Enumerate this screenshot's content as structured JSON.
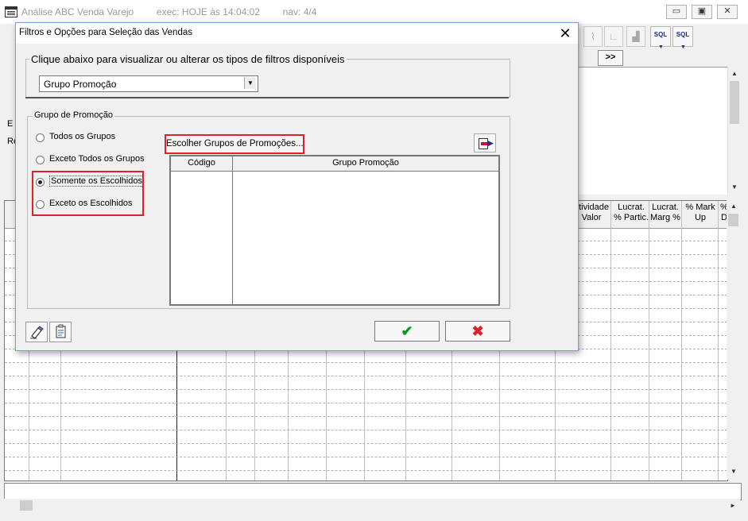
{
  "window": {
    "title": "Análise ABC Venda Varejo",
    "exec": "exec: HOJE às 14:04:02",
    "nav": "nav: 4/4",
    "minimize": "▭",
    "restore": "▣",
    "close": "✕"
  },
  "toolbar": {
    "sql_label": "SQL",
    "next_label": ">>"
  },
  "grid": {
    "headers": [
      "atividade\nValor",
      "Lucrat.\n% Partic.",
      "Lucrat.\nMarg %",
      "% Mark\nUp",
      "%\nD"
    ]
  },
  "dialog": {
    "title": "Filtros e Opções para Seleção das Vendas",
    "close": "✕",
    "filter_legend": "Clique abaixo para visualizar ou alterar os tipos de filtros disponíveis",
    "filter_select_value": "Grupo Promoção",
    "promo_legend": "Grupo de Promoção",
    "radios": [
      {
        "label": "Todos os Grupos",
        "checked": false
      },
      {
        "label": "Exceto Todos os Grupos",
        "checked": false
      },
      {
        "label": "Somente os Escolhidos",
        "checked": true
      },
      {
        "label": "Exceto os Escolhidos",
        "checked": false
      }
    ],
    "choose_button": "Escolher Grupos de Promoções...",
    "table": {
      "columns": [
        "Código",
        "Grupo Promoção"
      ]
    },
    "ok_symbol": "✔",
    "cancel_symbol": "✖"
  },
  "colors": {
    "highlight": "#e0202a",
    "ok_green": "#0a9a2a",
    "sql_blue": "#1a2e8a"
  },
  "icons": [
    "app-icon",
    "eraser-icon",
    "clipboard-icon",
    "export-icon",
    "check-icon",
    "x-icon"
  ]
}
